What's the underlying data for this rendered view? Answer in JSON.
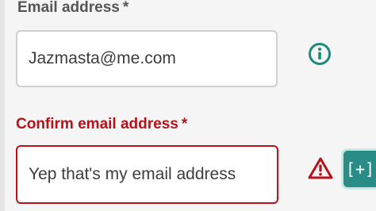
{
  "form": {
    "email": {
      "label": "Email address",
      "required_marker": "*",
      "value": "Jazmasta@me.com",
      "help_icon": "info-circle-icon"
    },
    "confirm_email": {
      "label": "Confirm email address",
      "required_marker": "*",
      "value": "Yep that's my email address",
      "error_icon": "warning-triangle-icon"
    }
  },
  "expand_button": {
    "label": "[+]"
  },
  "colors": {
    "error": "#b5121b",
    "info": "#1e8a7a",
    "label": "#555555",
    "input_border": "#cfcfcf",
    "accent": "#2a8c86"
  }
}
